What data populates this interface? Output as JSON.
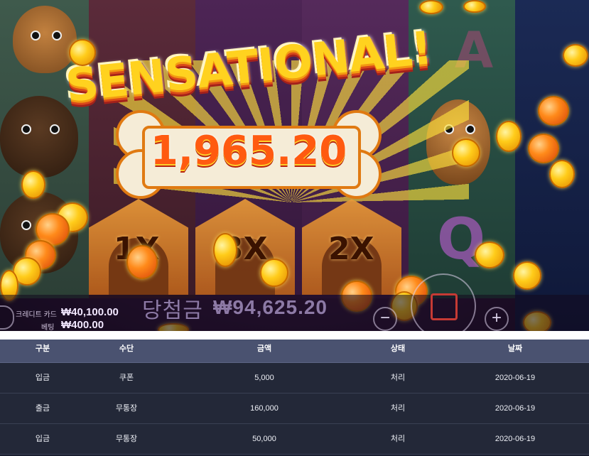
{
  "game": {
    "banner_title": "SENSATIONAL!",
    "win_amount": "1,965.20",
    "multipliers": [
      "1X",
      "3X",
      "2X"
    ],
    "symbols": [
      "Q",
      "A"
    ],
    "credit_label": "크레디트 카드",
    "credit_value": "₩40,100.00",
    "bet_label": "베팅",
    "bet_value": "₩400.00",
    "total_win_label": "당첨금",
    "total_win_value": "₩94,625.20",
    "minus_label": "−",
    "plus_label": "+"
  },
  "table": {
    "columns": [
      "구분",
      "수단",
      "금액",
      "상태",
      "날짜"
    ],
    "rows": [
      {
        "type": "입금",
        "method": "쿠폰",
        "amount": "5,000",
        "status": "처리",
        "date": "2020-06-19"
      },
      {
        "type": "출금",
        "method": "무통장",
        "amount": "160,000",
        "status": "처리",
        "date": "2020-06-19"
      },
      {
        "type": "입금",
        "method": "무통장",
        "amount": "50,000",
        "status": "처리",
        "date": "2020-06-19"
      }
    ]
  },
  "colors": {
    "title": "#ffd21f",
    "win_amount": "#ff5a10",
    "table_header": "#4a5270",
    "table_row": "#232838"
  },
  "icons": [
    "spin-stop-icon",
    "minus-icon",
    "plus-icon",
    "coin-icon",
    "dog-icon",
    "dog-house-icon",
    "bone-plaque-icon"
  ]
}
